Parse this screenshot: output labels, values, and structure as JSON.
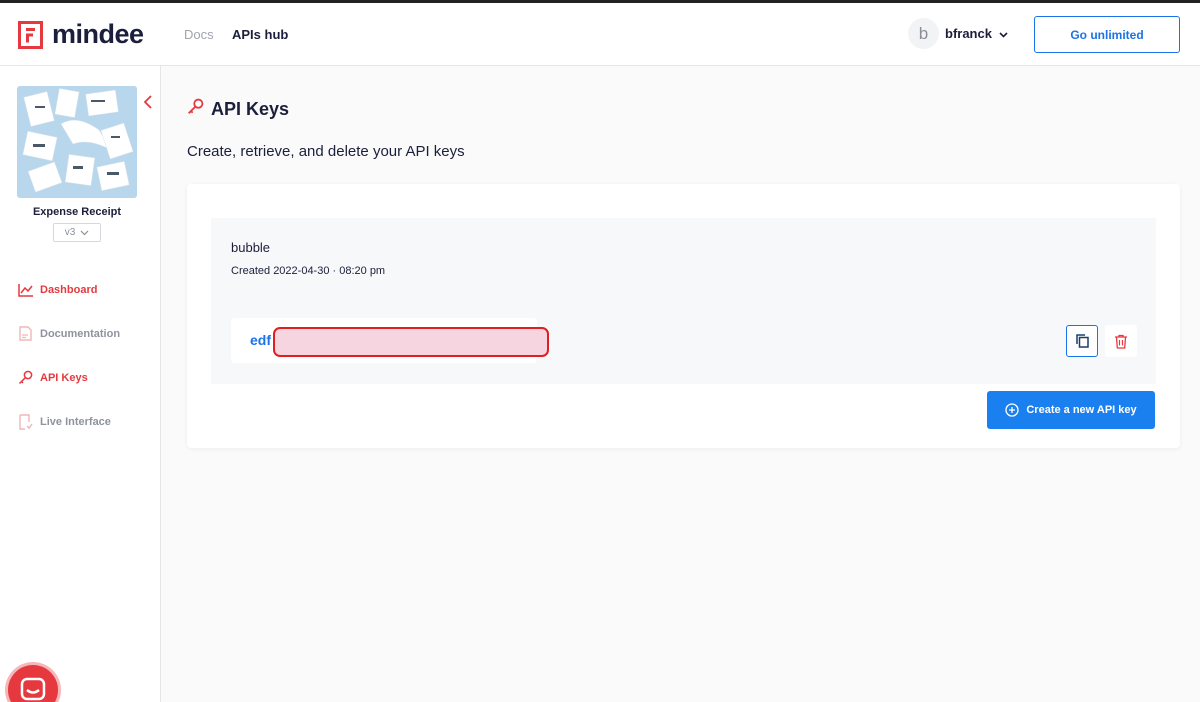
{
  "app": {
    "logo_text": "mindee",
    "brand_color": "#e5393f",
    "accent_color": "#1a73e8"
  },
  "header": {
    "nav": [
      {
        "label": "Docs"
      },
      {
        "label": "APIs hub"
      }
    ],
    "user": {
      "avatar_letter": "b",
      "name": "bfranck"
    },
    "cta_label": "Go unlimited"
  },
  "sidebar": {
    "product_name": "Expense Receipt",
    "version": "v3",
    "items": [
      {
        "label": "Dashboard",
        "icon": "chart-line-icon",
        "state": "active"
      },
      {
        "label": "Documentation",
        "icon": "document-icon",
        "state": "muted"
      },
      {
        "label": "API Keys",
        "icon": "key-icon",
        "state": "active"
      },
      {
        "label": "Live Interface",
        "icon": "live-document-icon",
        "state": "muted"
      }
    ]
  },
  "main": {
    "title": "API Keys",
    "subtitle": "Create, retrieve, and delete your API keys",
    "keys": [
      {
        "name": "bubble",
        "created": "Created 2022-04-30 · 08:20 pm",
        "value_prefix": "edf"
      }
    ],
    "create_label": "Create a new API key"
  }
}
